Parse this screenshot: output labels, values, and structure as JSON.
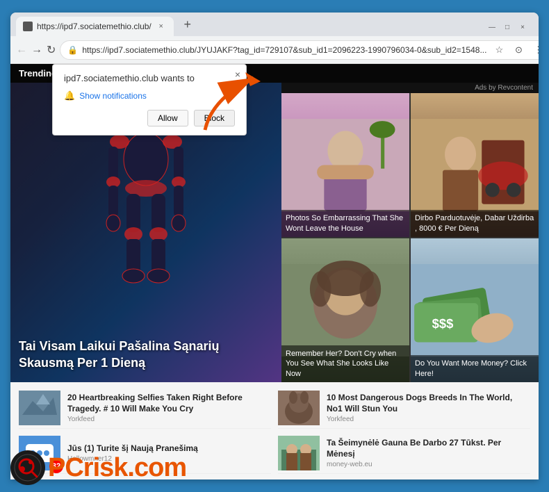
{
  "browser": {
    "tab_title": "https://ipd7.sociatemethio.club/",
    "tab_close": "×",
    "tab_new": "+",
    "win_minimize": "—",
    "win_maximize": "□",
    "win_close": "×",
    "url": "https://ipd7.sociatemethio.club/JYUJAKF?tag_id=729107&sub_id1=2096223-1990796034-0&sub_id2=1548...",
    "back": "←",
    "forward": "→",
    "refresh": "↻",
    "lock_icon": "🔒",
    "star_icon": "☆",
    "account_icon": "⊙",
    "menu_icon": "⋮"
  },
  "popup": {
    "title": "ipd7.sociatemethio.club wants to",
    "show_notifications": "Show notifications",
    "allow_btn": "Allow",
    "block_btn": "Block",
    "close": "×"
  },
  "page": {
    "trending_label": "Trending",
    "ads_label": "Ads by Revcontent",
    "hero_title": "Tai Visam Laikui Pašalina Sąnarių Skausmą Per 1 Dieną",
    "ad_captions": [
      "Photos So Embarrassing That She Wont Leave the House",
      "Dirbo Parduotuvėje, Dabar Uždirba , 8000 € Per Dieną",
      "Remember Her? Don't Cry when You See What She Looks Like Now",
      "Do You Want More Money? Click Here!"
    ],
    "bottom_items": [
      {
        "title": "20 Heartbreaking Selfies Taken Right Before Tragedy. # 10 Will Make You Cry",
        "source": "Yorkfeed"
      },
      {
        "title": "Jūs (1) Turite šį Naują Pranešimą",
        "source": "Hellowmner12"
      },
      {
        "title": "10 Most Dangerous Dogs Breeds In The World, No1 Will Stun You",
        "source": "Yorkfeed"
      },
      {
        "title": "Ta Šeimynėlė Gauna Be Darbo 27 Tūkst. Per Mėnesį",
        "source": "money-web.eu"
      }
    ]
  },
  "watermark": {
    "text_black": "PC",
    "text_orange": "risk.com"
  }
}
